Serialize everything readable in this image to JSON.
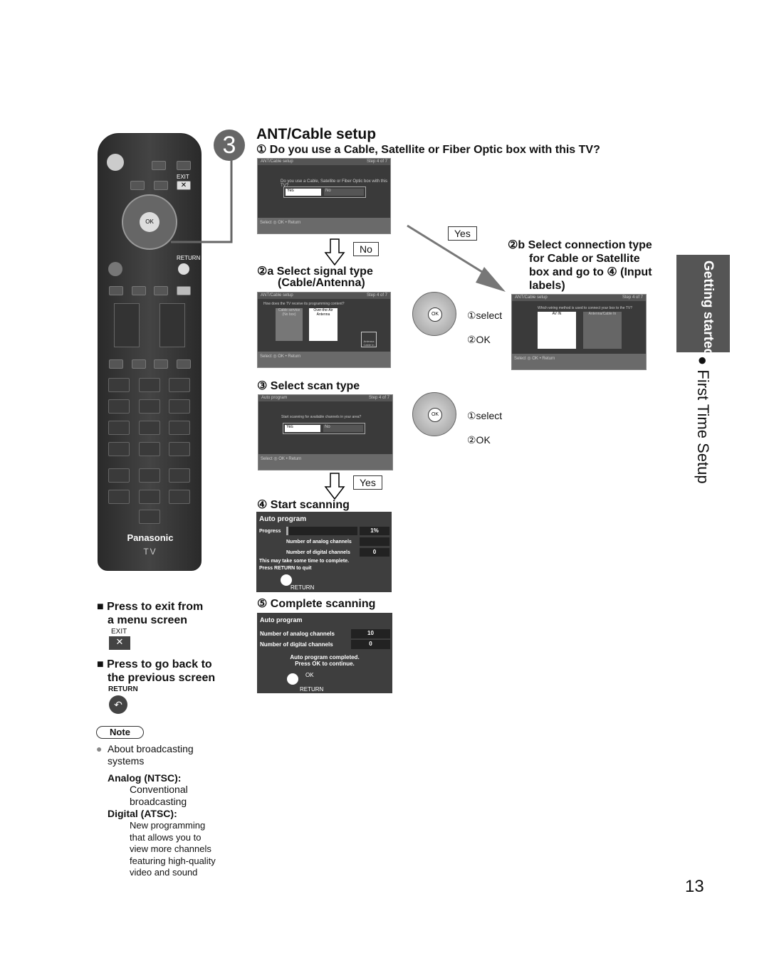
{
  "step": {
    "number": "3",
    "title": "ANT/Cable setup",
    "q1": "① Do you use a Cable, Satellite or Fiber Optic box with this TV?"
  },
  "screen1": {
    "title": "ANT/Cable setup",
    "step": "Step 4 of 7",
    "question": "Do you use a Cable, Satellite or Fiber Optic box with this TV?",
    "yes": "Yes",
    "no": "No",
    "select": "Select",
    "ok": "OK",
    "return": "Return"
  },
  "labels": {
    "no": "No",
    "yes": "Yes",
    "yes2": "Yes"
  },
  "s2a": {
    "title1": "②a Select signal type",
    "title2": "(Cable/Antenna)"
  },
  "screen2": {
    "title": "ANT/Cable setup",
    "step": "Step 4 of 7",
    "question": "How does the TV receive its programming content?",
    "opt1": "Cable service (No box)",
    "opt2": "Over-the-Air Antenna",
    "port": "Antenna Cable In"
  },
  "s2b": {
    "l1": "②b Select connection type",
    "l2": "for Cable or Satellite",
    "l3": "box and go to ④ (Input",
    "l4": "labels)"
  },
  "screen3": {
    "title": "ANT/Cable setup",
    "step": "Step 4 of 7",
    "question": "Which wiring method is used to connect your box to the TV?",
    "opt1": "AV IN",
    "opt2": "Antenna/Cable In"
  },
  "nav": {
    "select": "①select",
    "ok": "②OK",
    "dpad_ok": "OK"
  },
  "s3": {
    "title": "③ Select scan type"
  },
  "screen4": {
    "title": "Auto program",
    "step": "Step 4 of 7",
    "question": "Start scanning for available channels in your area?",
    "yes": "Yes",
    "no": "No"
  },
  "s4": {
    "title": "④ Start scanning",
    "panel": "Auto program",
    "progress": "Progress",
    "pct": "1%",
    "progress_value": 0.01,
    "analog": "Number of analog channels",
    "digital": "Number of digital channels",
    "digital_val": "0",
    "msg1": "This may take some time to complete.",
    "msg2": "Press RETURN to quit",
    "ret": "RETURN"
  },
  "s5": {
    "title": "⑤ Complete scanning",
    "panel": "Auto program",
    "analog": "Number of analog channels",
    "analog_val": "10",
    "digital": "Number of digital channels",
    "digital_val": "0",
    "msg1": "Auto program completed.",
    "msg2": "Press OK to continue.",
    "ok": "OK",
    "ret": "RETURN"
  },
  "remote": {
    "exit": "EXIT",
    "return": "RETURN",
    "ok": "OK",
    "brand": "Panasonic",
    "tv": "TV"
  },
  "left": {
    "exit1": "■ Press to exit from",
    "exit2": "a menu screen",
    "exit_btn": "EXIT",
    "ret1": "■ Press to go back to",
    "ret2": "the previous screen",
    "ret_btn": "RETURN",
    "note": "Note",
    "about": "About broadcasting systems",
    "analog_h": "Analog (NTSC):",
    "analog_t": "Conventional broadcasting",
    "digital_h": "Digital (ATSC):",
    "digital_t": "New programming that allows you to view more channels featuring high-quality video and sound"
  },
  "side": {
    "tab": "Getting started",
    "section": "● First Time Setup"
  },
  "page": "13"
}
